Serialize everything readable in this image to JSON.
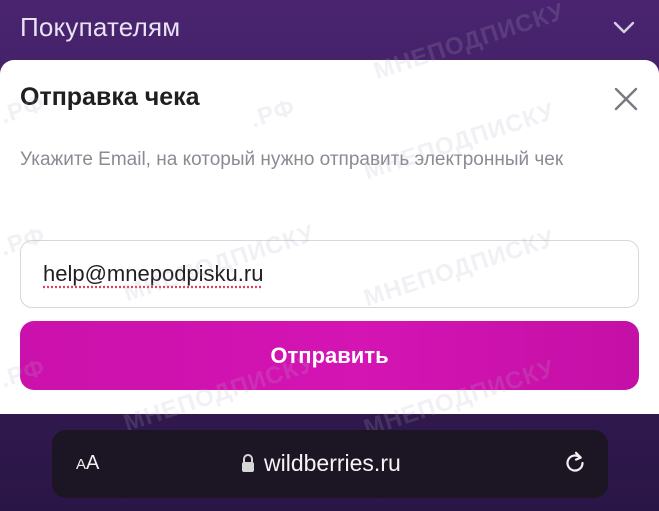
{
  "header": {
    "title": "Покупателям",
    "chevron_icon": "chevron-down-icon"
  },
  "receipt_sheet": {
    "title": "Отправка чека",
    "close_icon": "close-icon",
    "description": "Укажите Email, на который нужно отправить электронный чек",
    "email_value": "help@mnepodpisku.ru",
    "submit_label": "Отправить",
    "accent_color": "#cb11ab"
  },
  "browser": {
    "text_size_label_small": "A",
    "text_size_label_large": "A",
    "lock_icon": "lock-icon",
    "url": "wildberries.ru",
    "reload_icon": "reload-icon"
  },
  "watermark": {
    "brand": "МНЕПОДПИСКУ",
    "suffix": ".РФ"
  }
}
